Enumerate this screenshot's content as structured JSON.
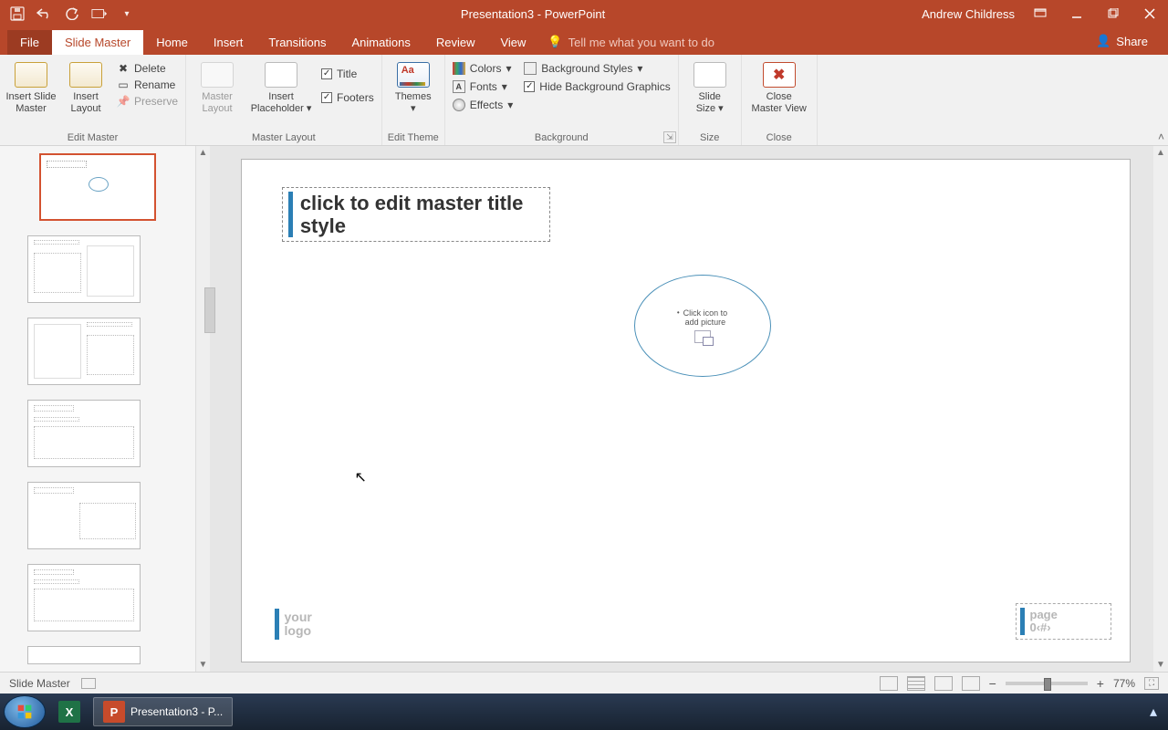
{
  "titlebar": {
    "title": "Presentation3 - PowerPoint",
    "user": "Andrew Childress"
  },
  "tabs": {
    "file": "File",
    "slide_master": "Slide Master",
    "home": "Home",
    "insert": "Insert",
    "transitions": "Transitions",
    "animations": "Animations",
    "review": "Review",
    "view": "View",
    "tellme": "Tell me what you want to do",
    "share": "Share"
  },
  "ribbon": {
    "edit_master": {
      "label": "Edit Master",
      "insert_slide_master": "Insert Slide\nMaster",
      "insert_layout": "Insert\nLayout",
      "delete": "Delete",
      "rename": "Rename",
      "preserve": "Preserve"
    },
    "master_layout": {
      "label": "Master Layout",
      "master_layout_btn": "Master\nLayout",
      "insert_placeholder": "Insert\nPlaceholder",
      "title": "Title",
      "footers": "Footers"
    },
    "edit_theme": {
      "label": "Edit Theme",
      "themes": "Themes"
    },
    "background": {
      "label": "Background",
      "colors": "Colors",
      "fonts": "Fonts",
      "effects": "Effects",
      "bg_styles": "Background Styles",
      "hide_bg": "Hide Background Graphics"
    },
    "size": {
      "label": "Size",
      "slide_size": "Slide\nSize"
    },
    "close": {
      "label": "Close",
      "close_master": "Close\nMaster View"
    }
  },
  "slide": {
    "title_placeholder": "click to edit master title style",
    "oval_text": "Click icon to\nadd picture",
    "logo_line1": "your",
    "logo_line2": "logo",
    "page_line1": "page",
    "page_line2": "0‹#›"
  },
  "statusbar": {
    "mode": "Slide Master",
    "zoom": "77%"
  },
  "taskbar": {
    "ppt_label": "Presentation3 - P..."
  }
}
